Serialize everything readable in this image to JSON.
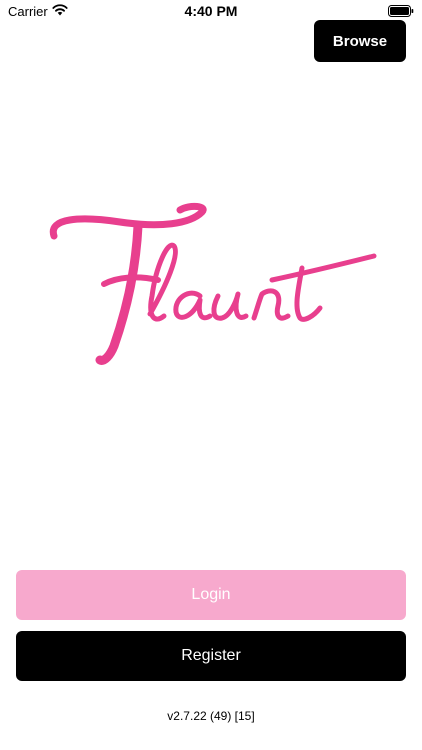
{
  "status_bar": {
    "carrier": "Carrier",
    "time": "4:40 PM",
    "wifi_icon": "wifi-icon",
    "battery_icon": "battery-icon"
  },
  "header": {
    "browse_label": "Browse"
  },
  "logo": {
    "text": "Flaunt",
    "color": "#e83f8e"
  },
  "actions": {
    "login_label": "Login",
    "register_label": "Register",
    "login_color": "#f7a9cd",
    "register_color": "#000000"
  },
  "footer": {
    "version": "v2.7.22 (49) [15]"
  }
}
